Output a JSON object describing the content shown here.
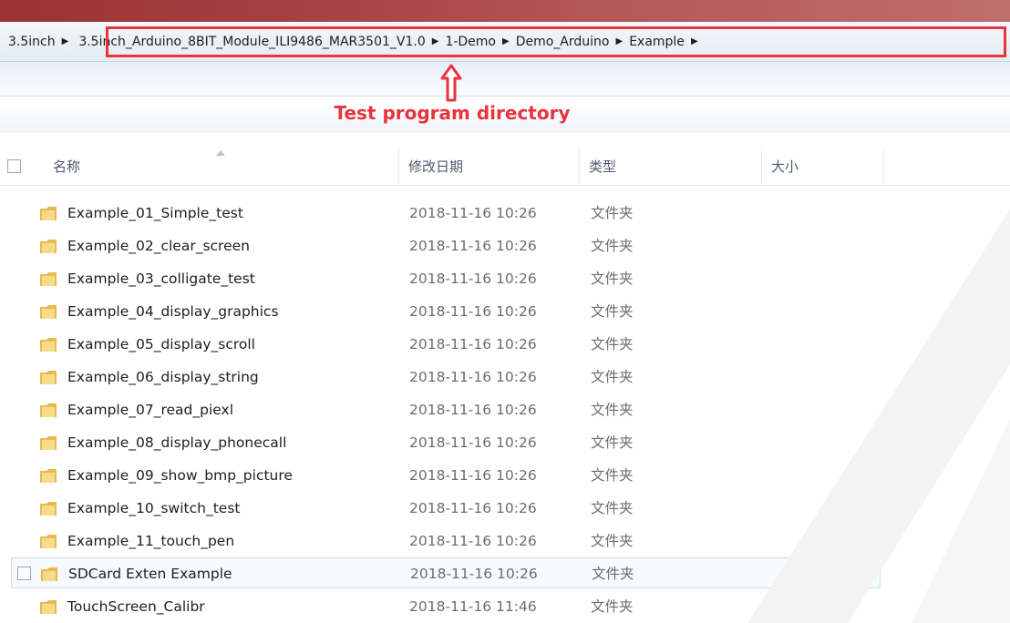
{
  "breadcrumb": {
    "items": [
      "3.5inch",
      "3.5inch_Arduino_8BIT_Module_ILI9486_MAR3501_V1.0",
      "1-Demo",
      "Demo_Arduino",
      "Example"
    ]
  },
  "annotation": {
    "text": "Test program directory",
    "color": "#e8343c"
  },
  "columns": {
    "name": "名称",
    "modified": "修改日期",
    "type": "类型",
    "size": "大小"
  },
  "files": [
    {
      "name": "Example_01_Simple_test",
      "date": "2018-11-16 10:26",
      "type": "文件夹"
    },
    {
      "name": "Example_02_clear_screen",
      "date": "2018-11-16 10:26",
      "type": "文件夹"
    },
    {
      "name": "Example_03_colligate_test",
      "date": "2018-11-16 10:26",
      "type": "文件夹"
    },
    {
      "name": "Example_04_display_graphics",
      "date": "2018-11-16 10:26",
      "type": "文件夹"
    },
    {
      "name": "Example_05_display_scroll",
      "date": "2018-11-16 10:26",
      "type": "文件夹"
    },
    {
      "name": "Example_06_display_string",
      "date": "2018-11-16 10:26",
      "type": "文件夹"
    },
    {
      "name": "Example_07_read_piexl",
      "date": "2018-11-16 10:26",
      "type": "文件夹"
    },
    {
      "name": "Example_08_display_phonecall",
      "date": "2018-11-16 10:26",
      "type": "文件夹"
    },
    {
      "name": "Example_09_show_bmp_picture",
      "date": "2018-11-16 10:26",
      "type": "文件夹"
    },
    {
      "name": "Example_10_switch_test",
      "date": "2018-11-16 10:26",
      "type": "文件夹"
    },
    {
      "name": "Example_11_touch_pen",
      "date": "2018-11-16 10:26",
      "type": "文件夹"
    },
    {
      "name": "SDCard Exten Example",
      "date": "2018-11-16 10:26",
      "type": "文件夹"
    },
    {
      "name": "TouchScreen_Calibr",
      "date": "2018-11-16 11:46",
      "type": "文件夹"
    }
  ],
  "icons": {
    "folder": "folder-icon",
    "breadcrumb_separator": "chevron-right-icon",
    "sort": "sort-ascending-icon",
    "annotation_arrow": "arrow-up-icon"
  }
}
